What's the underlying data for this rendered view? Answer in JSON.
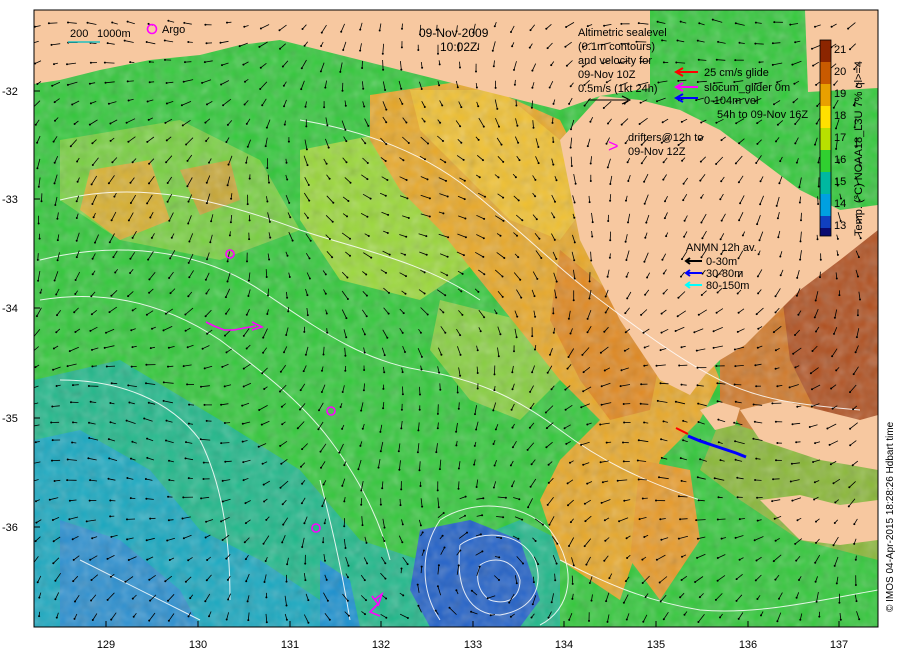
{
  "header": {
    "date": "09-Nov-2009",
    "time": "10:02Z"
  },
  "scale_bar": {
    "label_200": "200",
    "label_1000": "1000m"
  },
  "argo_label": "Argo",
  "altimetry_note": {
    "lines": [
      "Altimetric sealevel",
      "(0.1m contours)",
      "and velocity for",
      "09-Nov 10Z",
      "0.5m/s (1kt 24h)"
    ]
  },
  "glider_legend": {
    "items": [
      {
        "label": "25 cm/s glide",
        "color": "#ff0000"
      },
      {
        "label": "slocum_glider 0m",
        "color": "#ff00ff"
      },
      {
        "label": "0-104m vel",
        "color": "#0000ff"
      },
      {
        "label": "54h to 09-Nov 16Z",
        "color": "#000000"
      }
    ]
  },
  "drifters_note": {
    "symbol": ">",
    "lines": [
      "drifters@12h to",
      "09-Nov 12Z"
    ],
    "color": "#ff00ff"
  },
  "anmn_legend": {
    "title": "ANMN 12h av.",
    "items": [
      {
        "label": "0-30m",
        "color": "#000000"
      },
      {
        "label": "30-80m",
        "color": "#0000ff"
      },
      {
        "label": "80-150m",
        "color": "#00ffff"
      }
    ]
  },
  "colorbar": {
    "title": "Temp. (°C) NOAA18_L3U 7% ql>=4",
    "ticks": [
      "21",
      "20",
      "19",
      "18",
      "17",
      "16",
      "15",
      "14",
      "13"
    ],
    "colors": [
      "#8b2500",
      "#c85a00",
      "#e8a000",
      "#ffe000",
      "#b8e000",
      "#30d030",
      "#00b8a0",
      "#00a0e0",
      "#1040c0",
      "#0a0a70"
    ]
  },
  "axes": {
    "x_ticks": [
      "129",
      "130",
      "131",
      "132",
      "133",
      "134",
      "135",
      "136",
      "137"
    ],
    "y_ticks": [
      "-32",
      "-33",
      "-34",
      "-35",
      "-36"
    ]
  },
  "credit": "© IMOS 04-Apr-2015 18:28:26 Hdbart time",
  "colors": {
    "land": "#f7c8a0",
    "sea_warm": "#e8a020",
    "sea_green": "#30c830"
  }
}
